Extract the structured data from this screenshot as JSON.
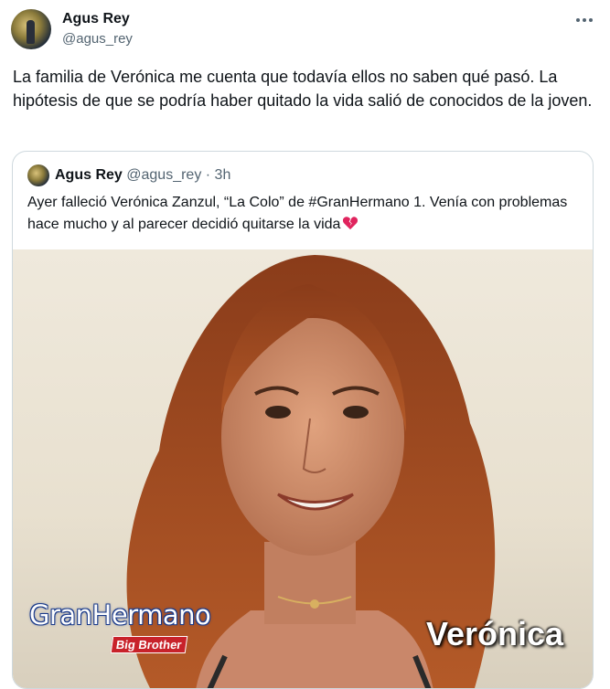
{
  "tweet": {
    "author_name": "Agus Rey",
    "author_handle": "@agus_rey",
    "text": "La familia de Verónica me cuenta que todavía ellos no saben qué pasó. La hipótesis de que se podría haber quitado la vida salió de conocidos de la joven.",
    "more_icon": "more-horizontal-icon"
  },
  "quote": {
    "author_name": "Agus Rey",
    "author_handle": "@agus_rey",
    "separator": "·",
    "time": "3h",
    "text": "Ayer falleció Verónica Zanzul, “La Colo” de #GranHermano 1. Venía con problemas hace mucho y al parecer decidió quitarse la vida",
    "emoji_icon": "broken-heart-icon",
    "image": {
      "logo_text": "GranHermano",
      "badge_text": "Big Brother",
      "caption": "Verónica"
    }
  },
  "colors": {
    "text_primary": "#0f1419",
    "text_secondary": "#536471",
    "border": "#cfd9de",
    "broken_heart": "#e0245e"
  }
}
